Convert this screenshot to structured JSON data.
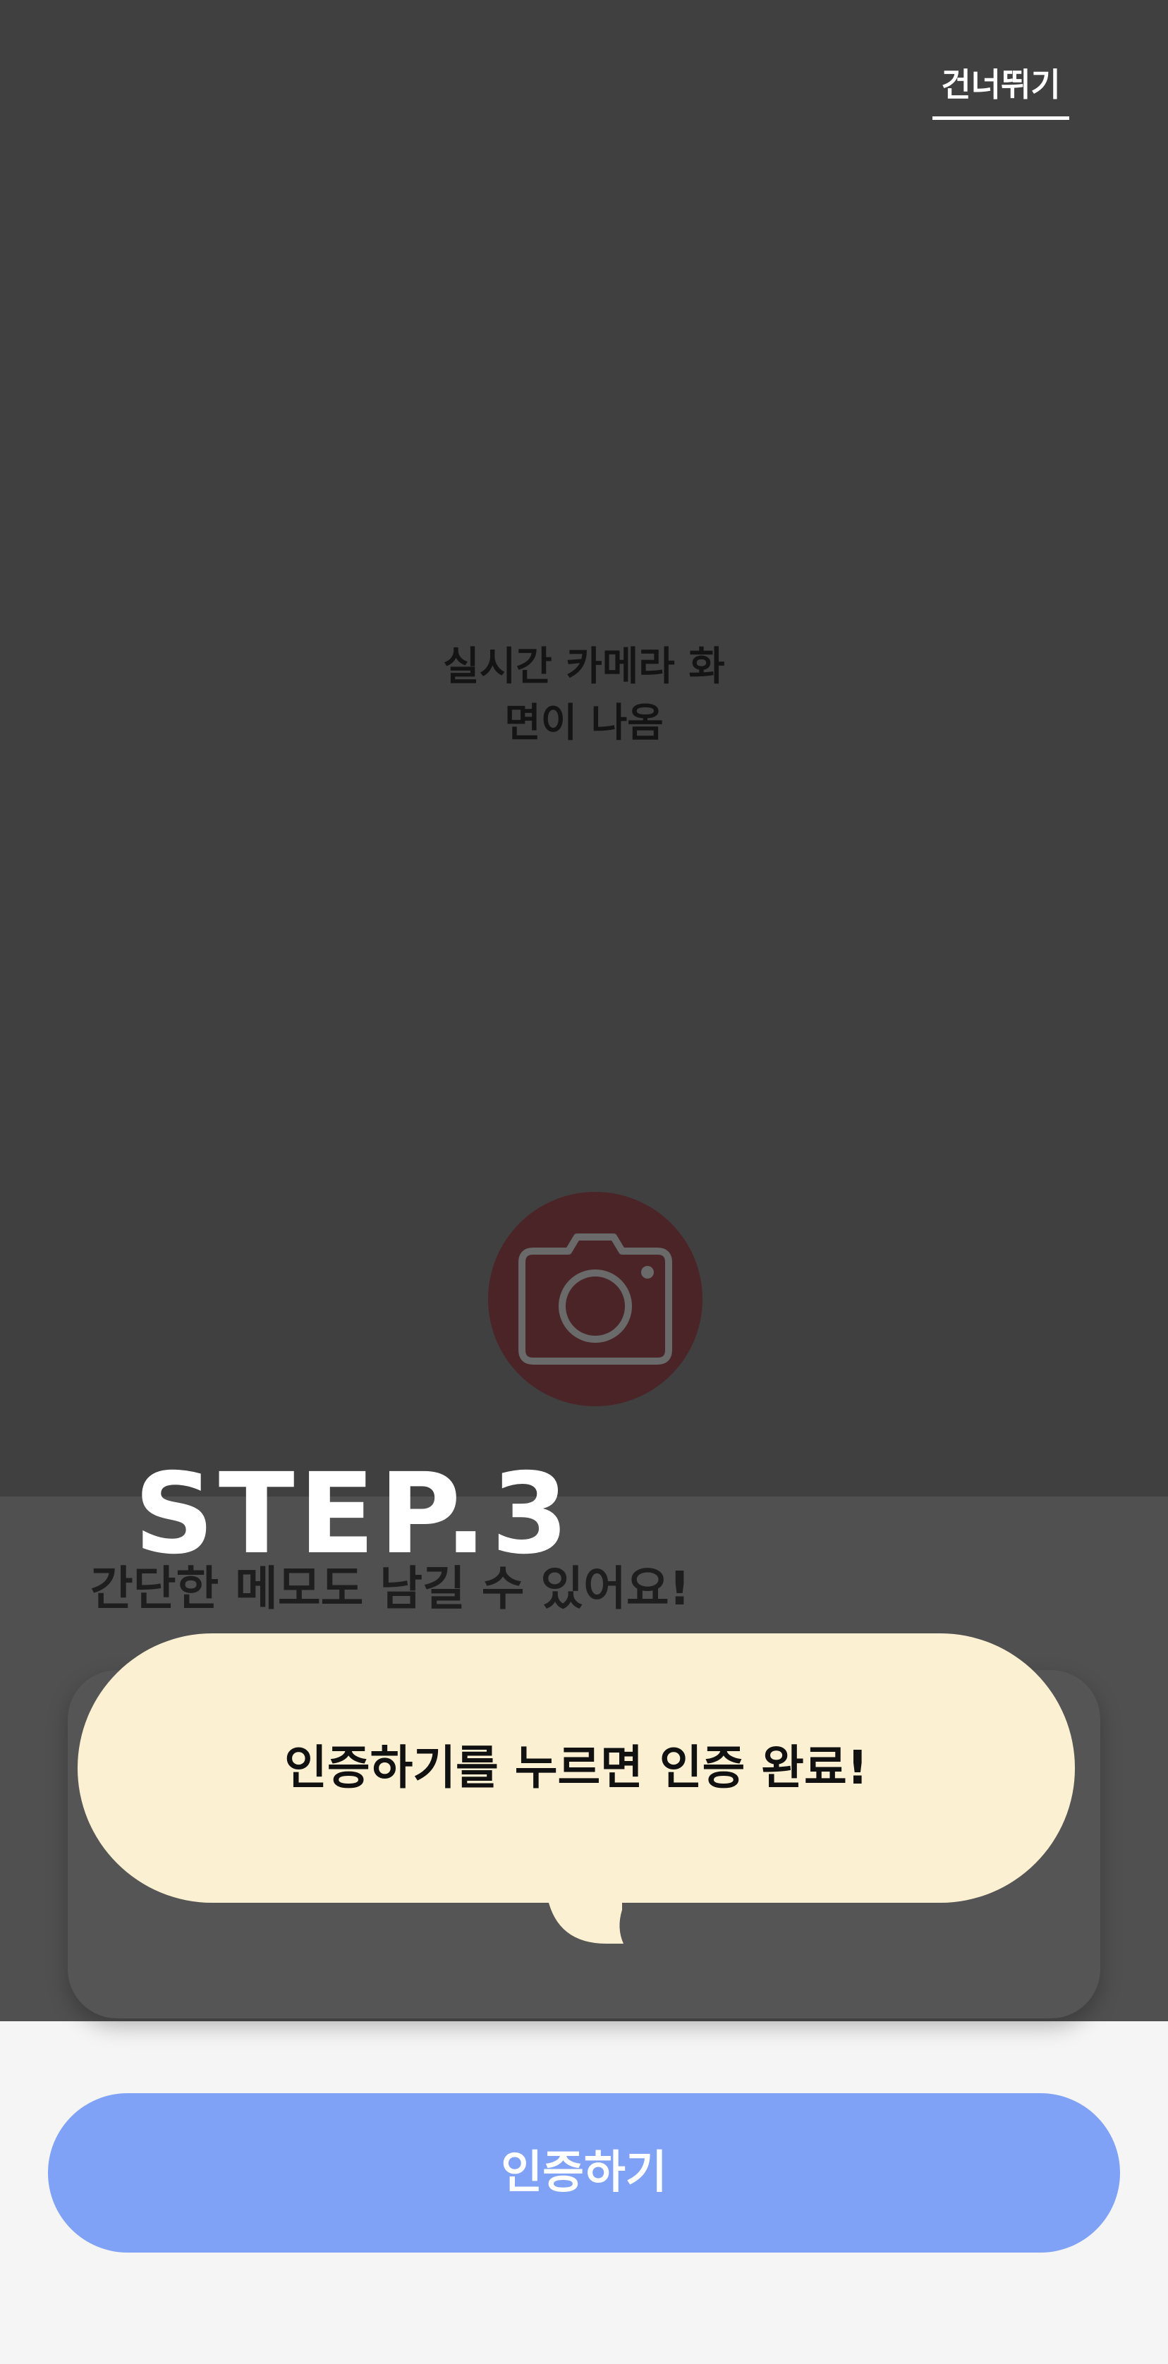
{
  "header": {
    "skip_label": "건너뛰기"
  },
  "camera": {
    "preview_line1": "실시간 카메라 화",
    "preview_line2": "면이 나옴",
    "shutter_icon": "camera-icon"
  },
  "onboarding": {
    "step_label": "STEP.3",
    "description": "간단한 메모도 남길 수 있어요!",
    "tooltip_text": "인증하기를 누르면 인증 완료!"
  },
  "footer": {
    "auth_button_label": "인증하기"
  },
  "colors": {
    "camera_background": "#404040",
    "overlay_background": "#505050",
    "shutter_fill": "#4b2428",
    "tooltip_fill": "#fbf0d2",
    "primary_button": "#7fa2f7",
    "page_background": "#f5f5f5"
  }
}
